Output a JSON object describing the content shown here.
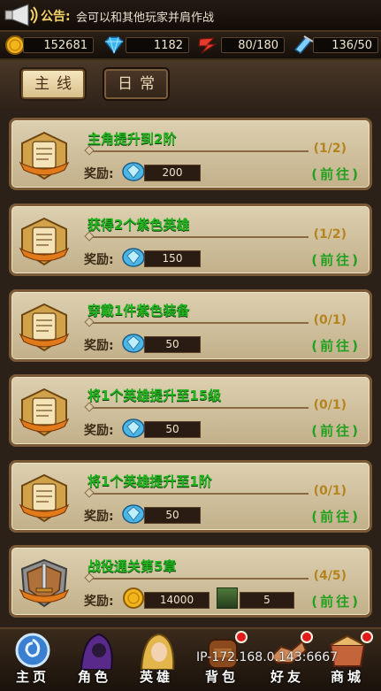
{
  "notice": {
    "label": "公告:",
    "text": "会可以和其他玩家并肩作战"
  },
  "resources": {
    "gold": "152681",
    "diamond": "1182",
    "stamina": "80/180",
    "energy": "136/50"
  },
  "tabs": [
    {
      "label": "主线"
    },
    {
      "label": "日常"
    }
  ],
  "reward_label": "奖励:",
  "goto_label": "(前往)",
  "quests": [
    {
      "title": "主角提升到2阶",
      "progress": "(1/2)",
      "reward_gems": "200"
    },
    {
      "title": "获得2个紫色英雄",
      "progress": "(1/2)",
      "reward_gems": "150"
    },
    {
      "title": "穿戴1件紫色装备",
      "progress": "(0/1)",
      "reward_gems": "50"
    },
    {
      "title": "将1个英雄提升至15级",
      "progress": "(0/1)",
      "reward_gems": "50"
    },
    {
      "title": "将1个英雄提升至1阶",
      "progress": "(0/1)",
      "reward_gems": "50"
    }
  ],
  "campaign_quest": {
    "title": "战役通关第5章",
    "progress": "(4/5)",
    "reward_gold": "14000",
    "reward_item": "5"
  },
  "nav": [
    {
      "label": "主页"
    },
    {
      "label": "角色"
    },
    {
      "label": "英雄"
    },
    {
      "label": "背包"
    },
    {
      "label": "好友"
    },
    {
      "label": "商城"
    }
  ],
  "ip_text": "IP-172.168.0.143:6667"
}
